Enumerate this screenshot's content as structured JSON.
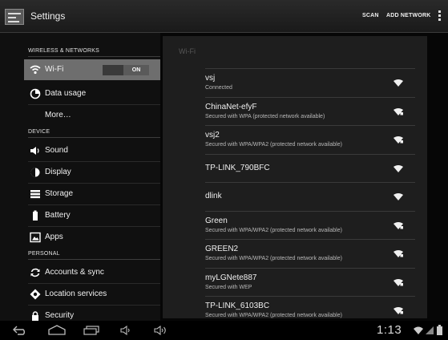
{
  "action_bar": {
    "title": "Settings",
    "scan_label": "SCAN",
    "add_network_label": "ADD NETWORK",
    "app_icon": "settings-icon",
    "overflow_icon": "overflow-menu-icon"
  },
  "sidebar": {
    "headers": {
      "wireless": "WIRELESS & NETWORKS",
      "device": "DEVICE",
      "personal": "PERSONAL"
    },
    "items": [
      {
        "label": "Wi-Fi",
        "icon": "wifi-icon",
        "toggle": "ON",
        "selected": true
      },
      {
        "label": "Data usage",
        "icon": "data-usage-icon"
      },
      {
        "label": "More…",
        "icon": ""
      },
      {
        "label": "Sound",
        "icon": "sound-icon"
      },
      {
        "label": "Display",
        "icon": "display-icon"
      },
      {
        "label": "Storage",
        "icon": "storage-icon"
      },
      {
        "label": "Battery",
        "icon": "battery-icon"
      },
      {
        "label": "Apps",
        "icon": "apps-icon"
      },
      {
        "label": "Accounts & sync",
        "icon": "sync-icon"
      },
      {
        "label": "Location services",
        "icon": "location-icon"
      },
      {
        "label": "Security",
        "icon": "lock-icon"
      }
    ]
  },
  "wifi_panel": {
    "title": "Wi-Fi",
    "networks": [
      {
        "name": "vsj",
        "status": "Connected",
        "secured": false
      },
      {
        "name": "ChinaNet-efyF",
        "status": "Secured with WPA (protected network available)",
        "secured": true
      },
      {
        "name": "vsj2",
        "status": "Secured with WPA/WPA2 (protected network available)",
        "secured": true
      },
      {
        "name": "TP-LINK_790BFC",
        "status": "",
        "secured": false
      },
      {
        "name": "dlink",
        "status": "",
        "secured": false
      },
      {
        "name": "Green",
        "status": "Secured with WPA/WPA2 (protected network available)",
        "secured": true
      },
      {
        "name": "GREEN2",
        "status": "Secured with WPA/WPA2 (protected network available)",
        "secured": true
      },
      {
        "name": "myLGNete887",
        "status": "Secured with WEP",
        "secured": true
      },
      {
        "name": "TP-LINK_6103BC",
        "status": "Secured with WPA/WPA2 (protected network available)",
        "secured": true
      }
    ]
  },
  "nav_bar": {
    "clock": "1:13",
    "icons": [
      "back-icon",
      "home-icon",
      "recents-icon",
      "volume-down-icon",
      "volume-up-icon",
      "wifi-status-icon",
      "cell-signal-icon",
      "battery-status-icon"
    ]
  }
}
